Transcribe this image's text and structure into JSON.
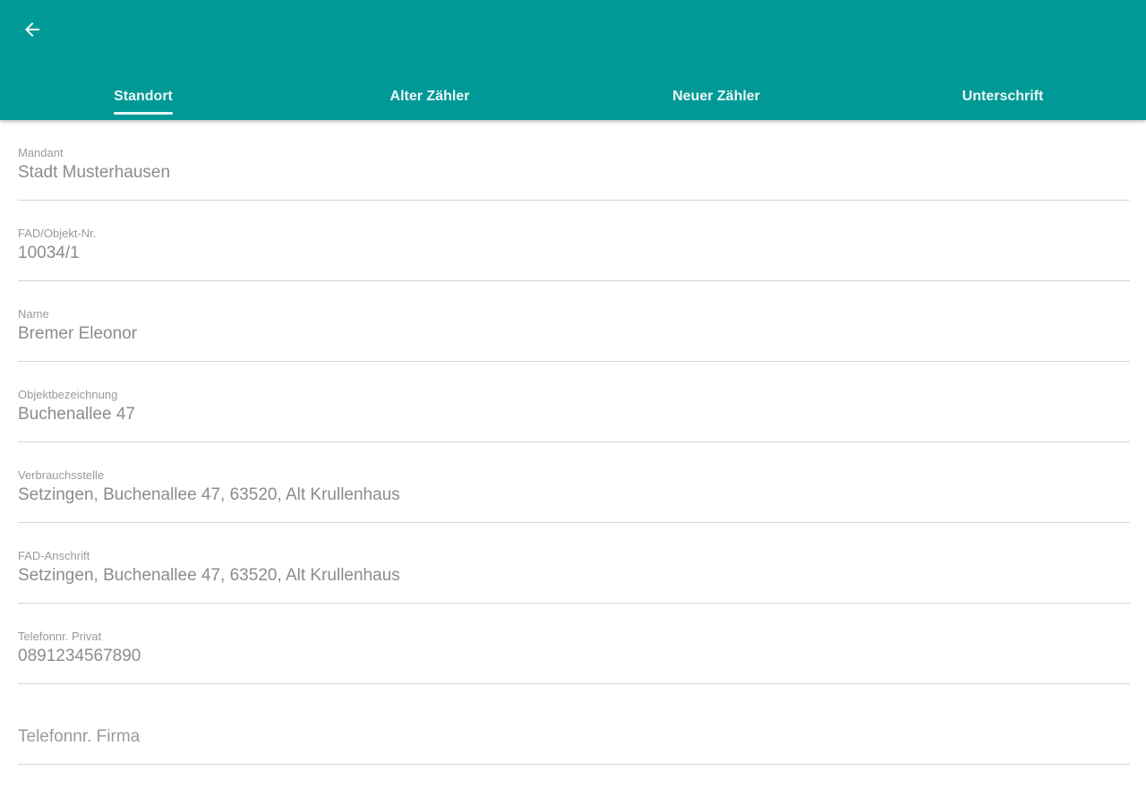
{
  "appbar": {
    "color": "#009996",
    "back_icon": "arrow-left-icon"
  },
  "tabs": [
    {
      "label": "Standort",
      "active": true
    },
    {
      "label": "Alter Zähler",
      "active": false
    },
    {
      "label": "Neuer Zähler",
      "active": false
    },
    {
      "label": "Unterschrift",
      "active": false
    }
  ],
  "form": {
    "mandant": {
      "label": "Mandant",
      "value": "Stadt Musterhausen"
    },
    "objekt_nr": {
      "label": "FAD/Objekt-Nr.",
      "value": "10034/1"
    },
    "name": {
      "label": "Name",
      "value": "Bremer Eleonor"
    },
    "objektbezeichnung": {
      "label": "Objektbezeichnung",
      "value": "Buchenallee 47"
    },
    "verbrauchsstelle": {
      "label": "Verbrauchsstelle",
      "value": "Setzingen, Buchenallee 47, 63520, Alt Krullenhaus"
    },
    "fad_anschrift": {
      "label": "FAD-Anschrift",
      "value": "Setzingen, Buchenallee 47, 63520, Alt Krullenhaus"
    },
    "telefon_privat": {
      "label": "Telefonnr. Privat",
      "value": "0891234567890"
    },
    "telefon_firma": {
      "placeholder": "Telefonnr. Firma"
    }
  }
}
